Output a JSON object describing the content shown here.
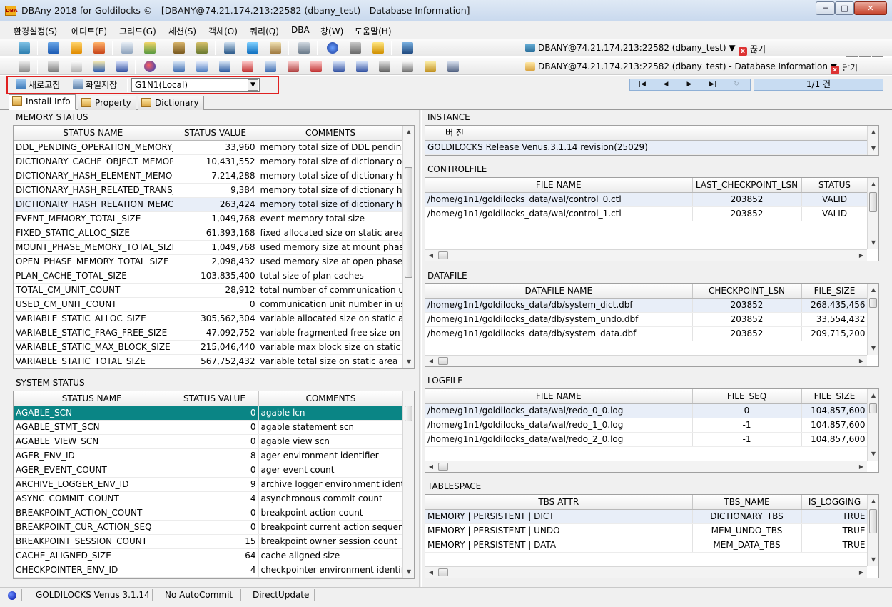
{
  "window": {
    "title": "DBAny 2018 for Goldilocks © - [DBANY@74.21.174.213:22582 (dbany_test) - Database Information]",
    "app_icon": "DBA",
    "minimize": "─",
    "maximize": "□",
    "close": "✕"
  },
  "menu": [
    "환경설정(S)",
    "에디트(E)",
    "그리드(G)",
    "세션(S)",
    "객체(O)",
    "쿼리(Q)",
    "DBA",
    "창(W)",
    "도움말(H)"
  ],
  "mdi": {
    "minimize": "_",
    "restore": "❐",
    "close": "x"
  },
  "toolbar": {
    "connection1": "DBANY@74.21.174.213:22582 (dbany_test) ▼",
    "disconnect": "끊기",
    "connection2": "DBANY@74.21.174.213:22582 (dbany_test) - Database Information ▼",
    "close": "닫기"
  },
  "actions": {
    "refresh": "새로고침",
    "save_file": "화일저장",
    "node": "G1N1(Local)",
    "nav_first": "|◀",
    "nav_prev": "◀",
    "nav_next": "▶",
    "nav_last": "▶|",
    "nav_refresh": "↻",
    "page_count": "1/1 건"
  },
  "tabs": [
    "Install Info",
    "Property",
    "Dictionary"
  ],
  "memory_status": {
    "title": "MEMORY STATUS",
    "columns": [
      "STATUS NAME",
      "STATUS VALUE",
      "COMMENTS"
    ],
    "rows": [
      [
        "DDL_PENDING_OPERATION_MEMORY_TOTAL_SIZE",
        "33,960",
        "memory total size of DDL pending operation"
      ],
      [
        "DICTIONARY_CACHE_OBJECT_MEMORY_TOTAL_SIZE",
        "10,431,552",
        "memory total size of dictionary object cache"
      ],
      [
        "DICTIONARY_HASH_ELEMENT_MEMORY_TOTAL_SIZE",
        "7,214,288",
        "memory total size of dictionary hash element"
      ],
      [
        "DICTIONARY_HASH_RELATED_TRANS_MEMORY_TOTAL_SIZE",
        "9,384",
        "memory total size of dictionary hash related trans"
      ],
      [
        "DICTIONARY_HASH_RELATION_MEMORY_TOTAL_SIZE",
        "263,424",
        "memory total size of dictionary hash relation"
      ],
      [
        "EVENT_MEMORY_TOTAL_SIZE",
        "1,049,768",
        "event memory total size"
      ],
      [
        "FIXED_STATIC_ALLOC_SIZE",
        "61,393,168",
        "fixed allocated size on static area"
      ],
      [
        "MOUNT_PHASE_MEMORY_TOTAL_SIZE",
        "1,049,768",
        "used memory size at mount phase"
      ],
      [
        "OPEN_PHASE_MEMORY_TOTAL_SIZE",
        "2,098,432",
        "used memory size at open phase"
      ],
      [
        "PLAN_CACHE_TOTAL_SIZE",
        "103,835,400",
        "total size of plan caches"
      ],
      [
        "TOTAL_CM_UNIT_COUNT",
        "28,912",
        "total number of communication unit"
      ],
      [
        "USED_CM_UNIT_COUNT",
        "0",
        "communication unit number in use"
      ],
      [
        "VARIABLE_STATIC_ALLOC_SIZE",
        "305,562,304",
        "variable allocated size on static area"
      ],
      [
        "VARIABLE_STATIC_FRAG_FREE_SIZE",
        "47,092,752",
        "variable fragmented free size on static area"
      ],
      [
        "VARIABLE_STATIC_MAX_BLOCK_SIZE",
        "215,046,440",
        "variable max block size on static area"
      ],
      [
        "VARIABLE_STATIC_TOTAL_SIZE",
        "567,752,432",
        "variable total size on static area"
      ]
    ]
  },
  "system_status": {
    "title": "SYSTEM STATUS",
    "columns": [
      "STATUS NAME",
      "STATUS VALUE",
      "COMMENTS"
    ],
    "rows": [
      [
        "AGABLE_SCN",
        "0",
        "agable lcn"
      ],
      [
        "AGABLE_STMT_SCN",
        "0",
        "agable statement scn"
      ],
      [
        "AGABLE_VIEW_SCN",
        "0",
        "agable view scn"
      ],
      [
        "AGER_ENV_ID",
        "8",
        "ager environment identifier"
      ],
      [
        "AGER_EVENT_COUNT",
        "0",
        "ager event count"
      ],
      [
        "ARCHIVE_LOGGER_ENV_ID",
        "9",
        "archive logger environment identifier"
      ],
      [
        "ASYNC_COMMIT_COUNT",
        "4",
        "asynchronous commit count"
      ],
      [
        "BREAKPOINT_ACTION_COUNT",
        "0",
        "breakpoint action count"
      ],
      [
        "BREAKPOINT_CUR_ACTION_SEQ",
        "0",
        "breakpoint current action sequence"
      ],
      [
        "BREAKPOINT_SESSION_COUNT",
        "15",
        "breakpoint owner session count"
      ],
      [
        "CACHE_ALIGNED_SIZE",
        "64",
        "cache aligned size"
      ],
      [
        "CHECKPOINTER_ENV_ID",
        "4",
        "checkpointer environment identifier"
      ]
    ]
  },
  "instance": {
    "title": "INSTANCE",
    "column": "버       전",
    "value": "GOLDILOCKS Release Venus.3.1.14 revision(25029)"
  },
  "controlfile": {
    "title": "CONTROLFILE",
    "columns": [
      "FILE NAME",
      "LAST_CHECKPOINT_LSN",
      "STATUS"
    ],
    "rows": [
      [
        "/home/g1n1/goldilocks_data/wal/control_0.ctl",
        "203852",
        "VALID"
      ],
      [
        "/home/g1n1/goldilocks_data/wal/control_1.ctl",
        "203852",
        "VALID"
      ]
    ]
  },
  "datafile": {
    "title": "DATAFILE",
    "columns": [
      "DATAFILE NAME",
      "CHECKPOINT_LSN",
      "FILE_SIZE"
    ],
    "rows": [
      [
        "/home/g1n1/goldilocks_data/db/system_dict.dbf",
        "203852",
        "268,435,456"
      ],
      [
        "/home/g1n1/goldilocks_data/db/system_undo.dbf",
        "203852",
        "33,554,432"
      ],
      [
        "/home/g1n1/goldilocks_data/db/system_data.dbf",
        "203852",
        "209,715,200"
      ]
    ]
  },
  "logfile": {
    "title": "LOGFILE",
    "columns": [
      "FILE NAME",
      "FILE_SEQ",
      "FILE_SIZE"
    ],
    "rows": [
      [
        "/home/g1n1/goldilocks_data/wal/redo_0_0.log",
        "0",
        "104,857,600"
      ],
      [
        "/home/g1n1/goldilocks_data/wal/redo_1_0.log",
        "-1",
        "104,857,600"
      ],
      [
        "/home/g1n1/goldilocks_data/wal/redo_2_0.log",
        "-1",
        "104,857,600"
      ]
    ]
  },
  "tablespace": {
    "title": "TABLESPACE",
    "columns": [
      "TBS ATTR",
      "TBS_NAME",
      "IS_LOGGING"
    ],
    "rows": [
      [
        "MEMORY | PERSISTENT | DICT",
        "DICTIONARY_TBS",
        "TRUE"
      ],
      [
        "MEMORY | PERSISTENT | UNDO",
        "MEM_UNDO_TBS",
        "TRUE"
      ],
      [
        "MEMORY | PERSISTENT | DATA",
        "MEM_DATA_TBS",
        "TRUE"
      ]
    ]
  },
  "statusbar": {
    "version": "GOLDILOCKS Venus 3.1.14",
    "autocommit": "No AutoCommit",
    "update_mode": "DirectUpdate"
  },
  "colors": {
    "selected_row": "#0a8585",
    "highlight_row": "#e8eef8",
    "red_box": "#e02020",
    "nav_bg": "#c8dcf2"
  },
  "icons": [
    "app-icon",
    "db-icon",
    "disconnect-icon",
    "refresh-icon",
    "save-file-icon",
    "tab-icon",
    "status-dot-icon"
  ]
}
